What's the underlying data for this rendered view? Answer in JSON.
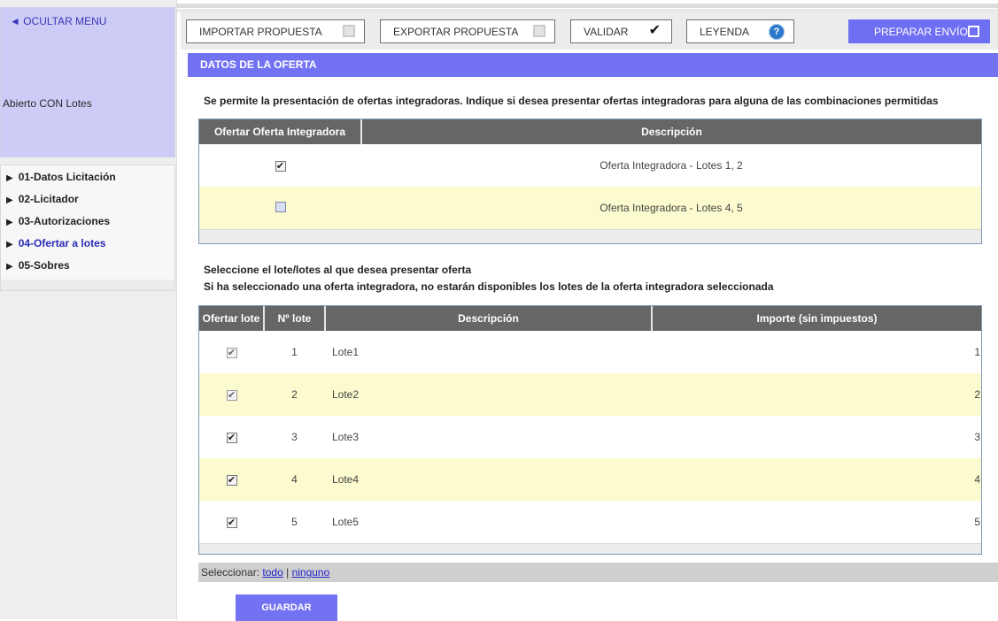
{
  "sidebar": {
    "hide_menu": "◄ OCULTAR MENU",
    "procedure_type": "Abierto CON Lotes",
    "items": [
      {
        "label": "01-Datos Licitación",
        "active": false
      },
      {
        "label": "02-Licitador",
        "active": false
      },
      {
        "label": "03-Autorizaciones",
        "active": false
      },
      {
        "label": "04-Ofertar a lotes",
        "active": true
      },
      {
        "label": "05-Sobres",
        "active": false
      }
    ]
  },
  "toolbar": {
    "import_label": "IMPORTAR PROPUESTA",
    "export_label": "EXPORTAR PROPUESTA",
    "validate_label": "VALIDAR",
    "legend_label": "LEYENDA",
    "send_label": "PREPARAR ENVÍO",
    "check_icon": "✔",
    "help_icon": "?"
  },
  "section": {
    "title": "DATOS DE LA OFERTA",
    "intro": "Se permite la presentación de ofertas integradoras. Indique si desea presentar ofertas integradoras para alguna de las combinaciones permitidas"
  },
  "integrator_table": {
    "headers": [
      "Ofertar Oferta Integradora",
      "Descripción"
    ],
    "rows": [
      {
        "checked": true,
        "description": "Oferta Integradora - Lotes 1, 2"
      },
      {
        "checked": false,
        "description": "Oferta Integradora - Lotes 4, 5"
      }
    ]
  },
  "lots_intro": {
    "line1": "Seleccione el lote/lotes al que desea presentar oferta",
    "line2": "Si ha seleccionado una oferta integradora, no estarán disponibles los lotes de la oferta integradora seleccionada"
  },
  "lots_table": {
    "headers": [
      "Ofertar lote",
      "Nº lote",
      "Descripción",
      "Importe (sin impuestos)"
    ],
    "rows": [
      {
        "checked": true,
        "disabled": true,
        "number": "1",
        "description": "Lote1",
        "amount": "1"
      },
      {
        "checked": true,
        "disabled": true,
        "number": "2",
        "description": "Lote2",
        "amount": "2"
      },
      {
        "checked": true,
        "disabled": false,
        "number": "3",
        "description": "Lote3",
        "amount": "3"
      },
      {
        "checked": true,
        "disabled": false,
        "number": "4",
        "description": "Lote4",
        "amount": "4"
      },
      {
        "checked": true,
        "disabled": false,
        "number": "5",
        "description": "Lote5",
        "amount": "5"
      }
    ]
  },
  "select_bar": {
    "prefix": "Seleccionar:",
    "all": "todo",
    "separator": "|",
    "none": "ninguno"
  },
  "save_label": "GUARDAR"
}
